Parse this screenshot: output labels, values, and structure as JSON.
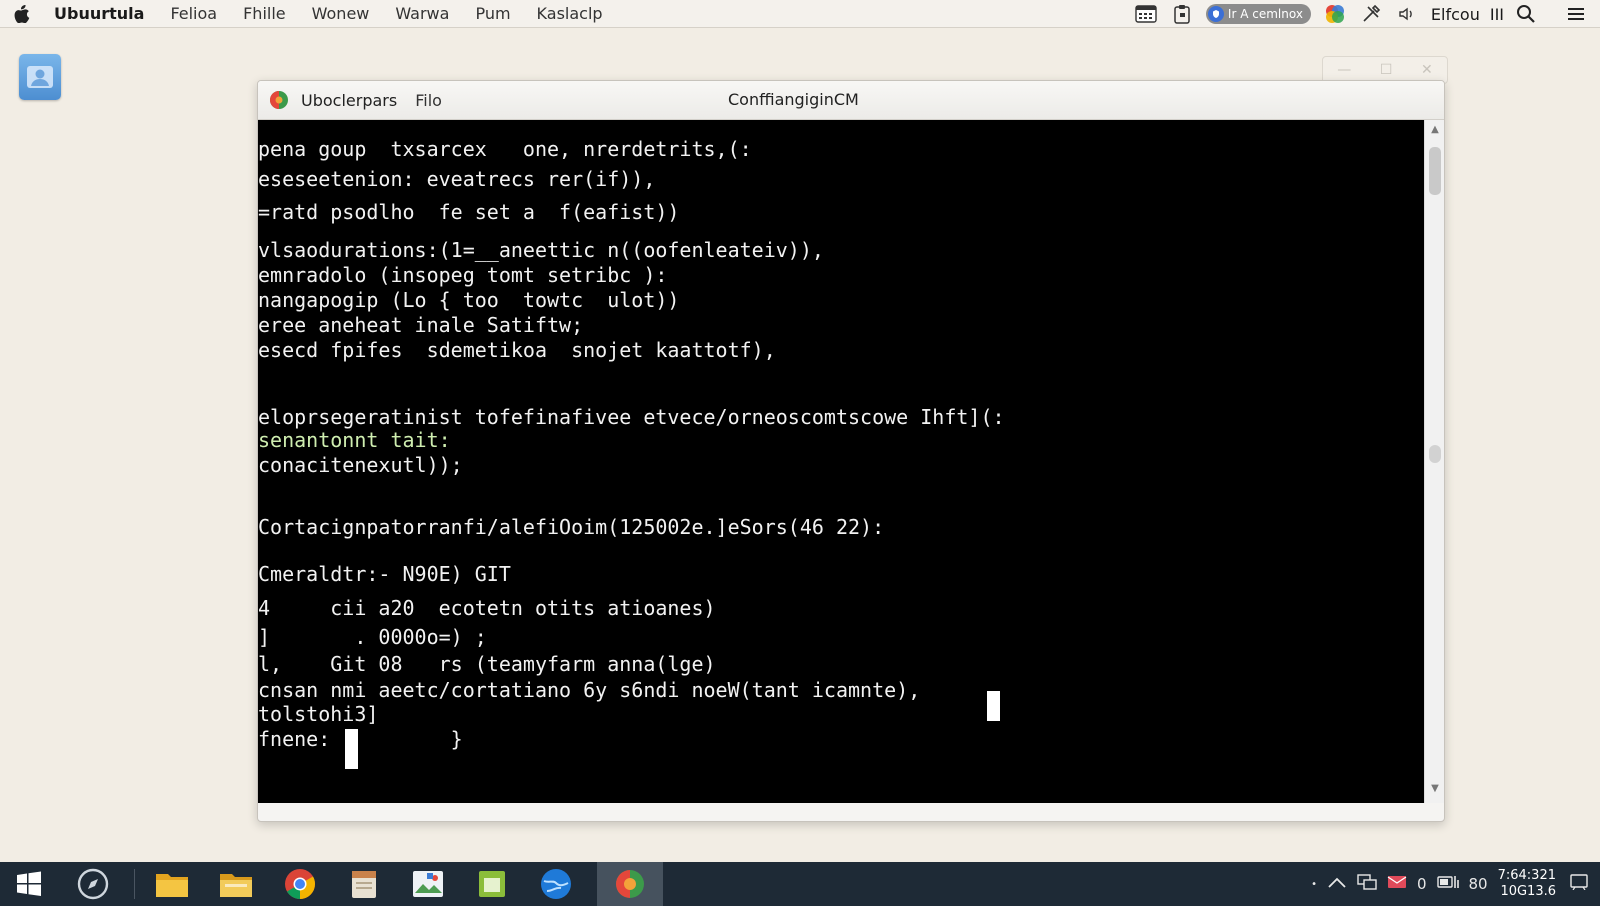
{
  "menubar": {
    "app_name": "Ubuurtula",
    "items": [
      "Felioa",
      "Fhille",
      "Wonew",
      "Warwa",
      "Pum",
      "Kaslaclp"
    ],
    "status_pill": "Ir A cemlnox",
    "clock": "Elfcou",
    "extra": "III"
  },
  "window": {
    "app_name": "Uboclerpars",
    "menu": "Filo",
    "title": "ConffiangiginCM"
  },
  "terminal": {
    "lines": [
      "pena goup  txsarcex   one, nrerdetrits,(:",
      "eseseetenion: eveatrecs rer(if)),",
      "=ratd psodlho  fe set a  f(eafist))",
      "vlsaodurations:(1=__aneettic n((oofenleateiv)),",
      "emnradolo (insopeg tomt setribc ):",
      "nangapogip (Lo { too  towtc  ulot))",
      "eree aneheat inale Satiftw;",
      "esecd fpifes  sdemetikoa  snojet kaattotf),",
      "eloprsegeratinist tofefinafivee etvece/orneoscomtscowe Ihft](:",
      "senantonnt tait:",
      "conacitenexutl));",
      "Cortacignpatorranfi/alefiOoim(125002e.]eSors(46 22):",
      "Cmeraldtr:- N90E) GIT",
      "4     cii a20  ecotetn otits atioanes)",
      "]       . 0000o=) ;",
      "l,    Git 08   rs (teamyfarm anna(lge)",
      "cnsan nmi aeetc/cortatiano 6y s6ndi noeW(tant icamnte),",
      "tolstohi3]",
      "fnene:          }"
    ]
  },
  "taskbar": {
    "clock_time": "7:64:321",
    "clock_date": "10G13.6",
    "tray_text": "0",
    "tray_text2": "80"
  },
  "colors": {
    "terminal_bg": "#000000",
    "terminal_fg": "#f2f2f2",
    "terminal_green": "#cfeeb0",
    "taskbar_bg": "#1e2a36"
  }
}
